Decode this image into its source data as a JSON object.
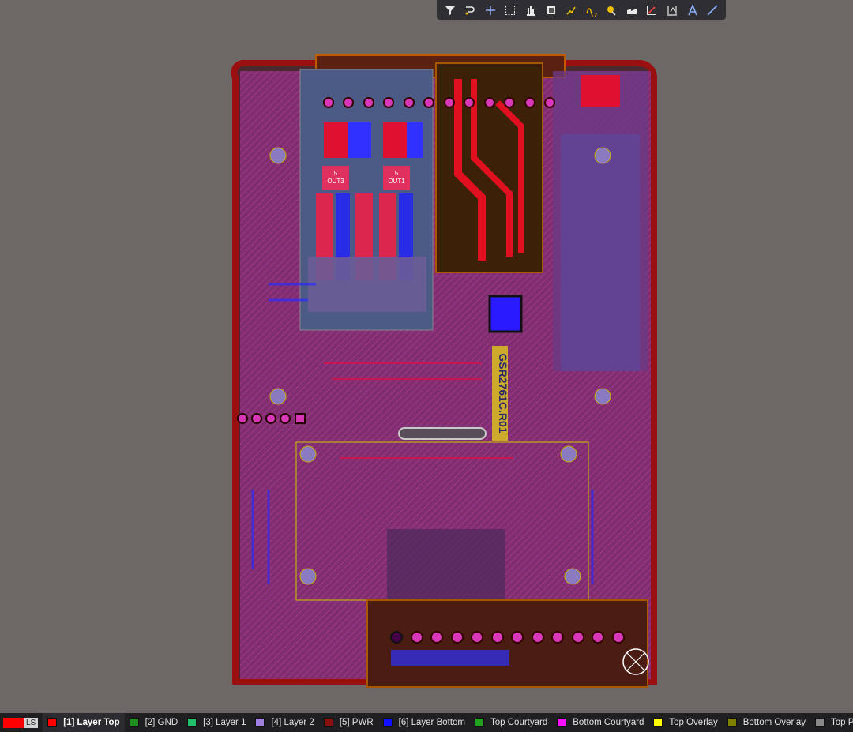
{
  "toolbar": {
    "buttons": [
      {
        "icon": "filter-icon"
      },
      {
        "icon": "route-icon"
      },
      {
        "icon": "crosshair-icon"
      },
      {
        "icon": "select-rect-icon"
      },
      {
        "icon": "align-icon"
      },
      {
        "icon": "component-icon"
      },
      {
        "icon": "interactive-route-icon"
      },
      {
        "icon": "differential-pair-icon"
      },
      {
        "icon": "via-icon"
      },
      {
        "icon": "polygon-pour-icon"
      },
      {
        "icon": "keepout-icon"
      },
      {
        "icon": "dimension-icon"
      },
      {
        "icon": "string-icon"
      },
      {
        "icon": "line-icon"
      }
    ]
  },
  "board": {
    "silk_labels": [
      "5",
      "OUT3",
      "5",
      "OUT1",
      "GSR2761C.R01"
    ]
  },
  "layer_bar": {
    "ls_label": "LS",
    "active": "[1] Layer Top",
    "layers": [
      {
        "label": "[1] Layer Top",
        "color": "#ff0000"
      },
      {
        "label": "[2] GND",
        "color": "#1e8f1e"
      },
      {
        "label": "[3] Layer 1",
        "color": "#22c06c"
      },
      {
        "label": "[4] Layer 2",
        "color": "#a080e0"
      },
      {
        "label": "[5] PWR",
        "color": "#8a0f0f"
      },
      {
        "label": "[6] Layer Bottom",
        "color": "#1010ff"
      },
      {
        "label": "Top Courtyard",
        "color": "#22a022"
      },
      {
        "label": "Bottom Courtyard",
        "color": "#ff10ff"
      },
      {
        "label": "Top Overlay",
        "color": "#ffff00"
      },
      {
        "label": "Bottom Overlay",
        "color": "#808000"
      },
      {
        "label": "Top Paste",
        "color": "#8a8a8a"
      }
    ]
  }
}
